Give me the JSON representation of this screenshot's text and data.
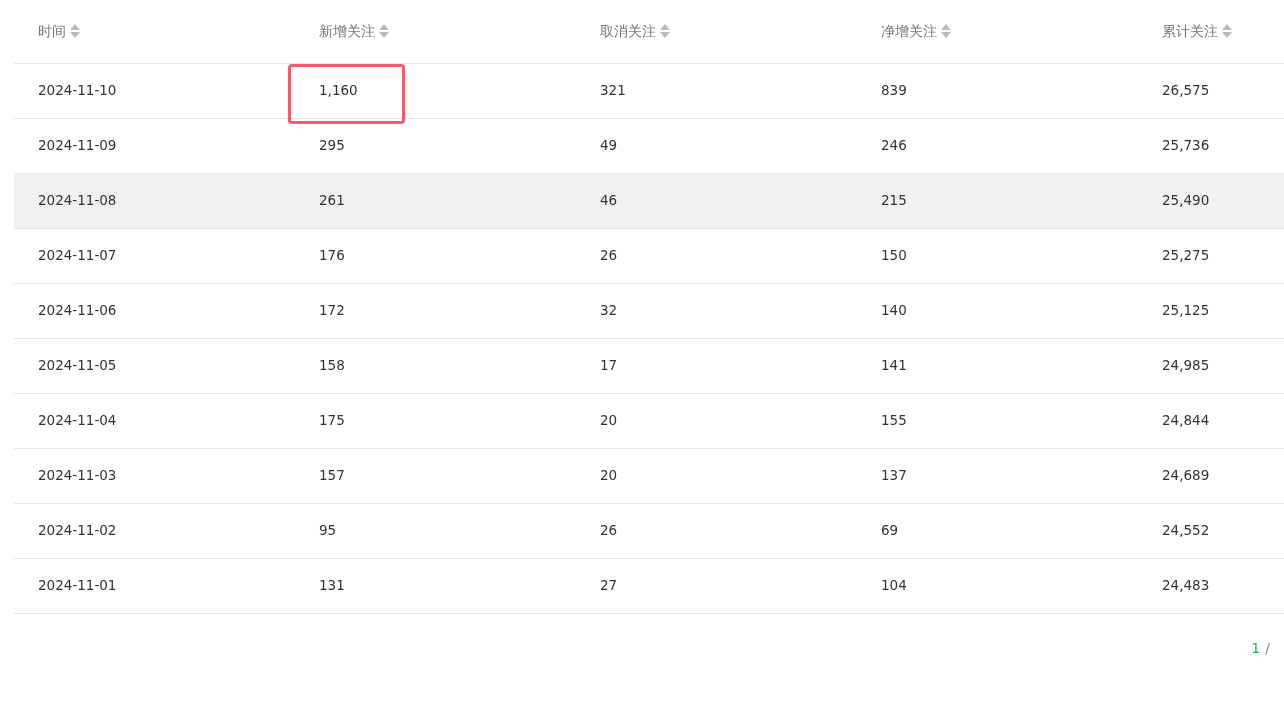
{
  "table": {
    "columns": [
      {
        "label": "时间"
      },
      {
        "label": "新增关注"
      },
      {
        "label": "取消关注"
      },
      {
        "label": "净增关注"
      },
      {
        "label": "累计关注"
      }
    ],
    "rows": [
      {
        "hovered": false,
        "cells": [
          {
            "text": "2024-11-10",
            "marked": false
          },
          {
            "text": "1,160",
            "marked": true
          },
          {
            "text": "321",
            "marked": false
          },
          {
            "text": "839",
            "marked": false
          },
          {
            "text": "26,575",
            "marked": false
          }
        ]
      },
      {
        "hovered": false,
        "cells": [
          {
            "text": "2024-11-09",
            "marked": false
          },
          {
            "text": "295",
            "marked": false
          },
          {
            "text": "49",
            "marked": false
          },
          {
            "text": "246",
            "marked": false
          },
          {
            "text": "25,736",
            "marked": false
          }
        ]
      },
      {
        "hovered": true,
        "cells": [
          {
            "text": "2024-11-08",
            "marked": false
          },
          {
            "text": "261",
            "marked": false
          },
          {
            "text": "46",
            "marked": false
          },
          {
            "text": "215",
            "marked": false
          },
          {
            "text": "25,490",
            "marked": false
          }
        ]
      },
      {
        "hovered": false,
        "cells": [
          {
            "text": "2024-11-07",
            "marked": false
          },
          {
            "text": "176",
            "marked": false
          },
          {
            "text": "26",
            "marked": false
          },
          {
            "text": "150",
            "marked": false
          },
          {
            "text": "25,275",
            "marked": false
          }
        ]
      },
      {
        "hovered": false,
        "cells": [
          {
            "text": "2024-11-06",
            "marked": false
          },
          {
            "text": "172",
            "marked": false
          },
          {
            "text": "32",
            "marked": false
          },
          {
            "text": "140",
            "marked": false
          },
          {
            "text": "25,125",
            "marked": false
          }
        ]
      },
      {
        "hovered": false,
        "cells": [
          {
            "text": "2024-11-05",
            "marked": false
          },
          {
            "text": "158",
            "marked": false
          },
          {
            "text": "17",
            "marked": false
          },
          {
            "text": "141",
            "marked": false
          },
          {
            "text": "24,985",
            "marked": false
          }
        ]
      },
      {
        "hovered": false,
        "cells": [
          {
            "text": "2024-11-04",
            "marked": false
          },
          {
            "text": "175",
            "marked": false
          },
          {
            "text": "20",
            "marked": false
          },
          {
            "text": "155",
            "marked": false
          },
          {
            "text": "24,844",
            "marked": false
          }
        ]
      },
      {
        "hovered": false,
        "cells": [
          {
            "text": "2024-11-03",
            "marked": false
          },
          {
            "text": "157",
            "marked": false
          },
          {
            "text": "20",
            "marked": false
          },
          {
            "text": "137",
            "marked": false
          },
          {
            "text": "24,689",
            "marked": false
          }
        ]
      },
      {
        "hovered": false,
        "cells": [
          {
            "text": "2024-11-02",
            "marked": false
          },
          {
            "text": "95",
            "marked": false
          },
          {
            "text": "26",
            "marked": false
          },
          {
            "text": "69",
            "marked": false
          },
          {
            "text": "24,552",
            "marked": false
          }
        ]
      },
      {
        "hovered": false,
        "cells": [
          {
            "text": "2024-11-01",
            "marked": false
          },
          {
            "text": "131",
            "marked": false
          },
          {
            "text": "27",
            "marked": false
          },
          {
            "text": "104",
            "marked": false
          },
          {
            "text": "24,483",
            "marked": false
          }
        ]
      }
    ]
  },
  "pagination": {
    "current": "1",
    "separator": "/"
  }
}
